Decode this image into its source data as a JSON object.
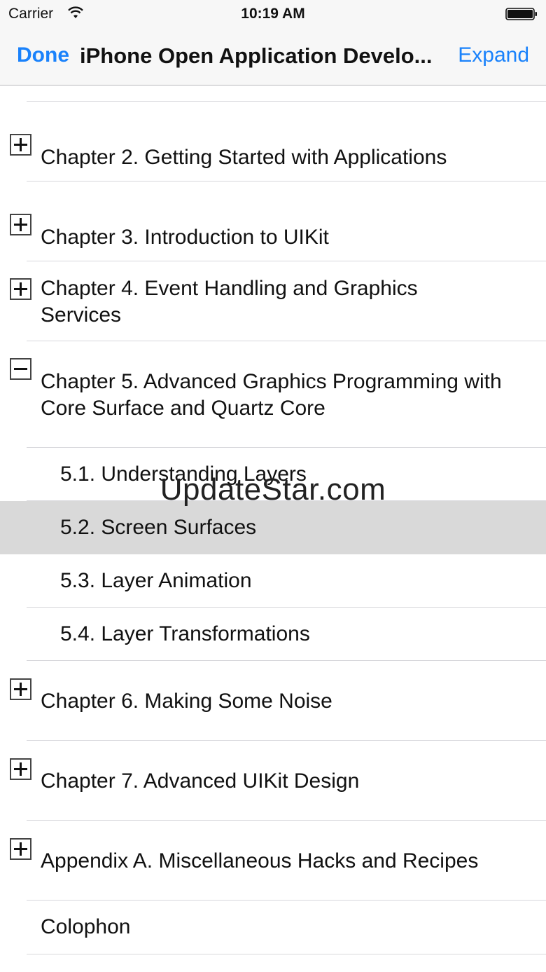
{
  "status_bar": {
    "carrier": "Carrier",
    "time": "10:19 AM",
    "wifi_icon": "wifi-icon",
    "battery_icon": "battery-icon"
  },
  "nav_bar": {
    "done_label": "Done",
    "title": "iPhone Open Application Develo...",
    "expand_label": "Expand"
  },
  "toc": {
    "items": [
      {
        "label": "Chapter 2. Getting Started with Applications",
        "toggle": "plus"
      },
      {
        "label": "Chapter 3. Introduction to UIKit",
        "toggle": "plus"
      },
      {
        "label": "Chapter 4. Event Handling and Graphics Services",
        "toggle": "plus"
      },
      {
        "label": "Chapter 5. Advanced Graphics Programming with Core Surface and Quartz Core",
        "toggle": "minus"
      },
      {
        "label": "5.1. Understanding Layers",
        "toggle": "none"
      },
      {
        "label": "5.2. Screen Surfaces",
        "toggle": "none",
        "selected": true
      },
      {
        "label": "5.3. Layer Animation",
        "toggle": "none"
      },
      {
        "label": "5.4. Layer Transformations",
        "toggle": "none"
      },
      {
        "label": "Chapter 6. Making Some Noise",
        "toggle": "plus"
      },
      {
        "label": "Chapter 7. Advanced UIKit Design",
        "toggle": "plus"
      },
      {
        "label": "Appendix A. Miscellaneous Hacks and Recipes",
        "toggle": "plus"
      },
      {
        "label": "Colophon",
        "toggle": "none"
      }
    ]
  },
  "watermark": "UpdateStar.com",
  "colors": {
    "accent": "#1a82fb",
    "selected_row": "#d9d9d9"
  }
}
